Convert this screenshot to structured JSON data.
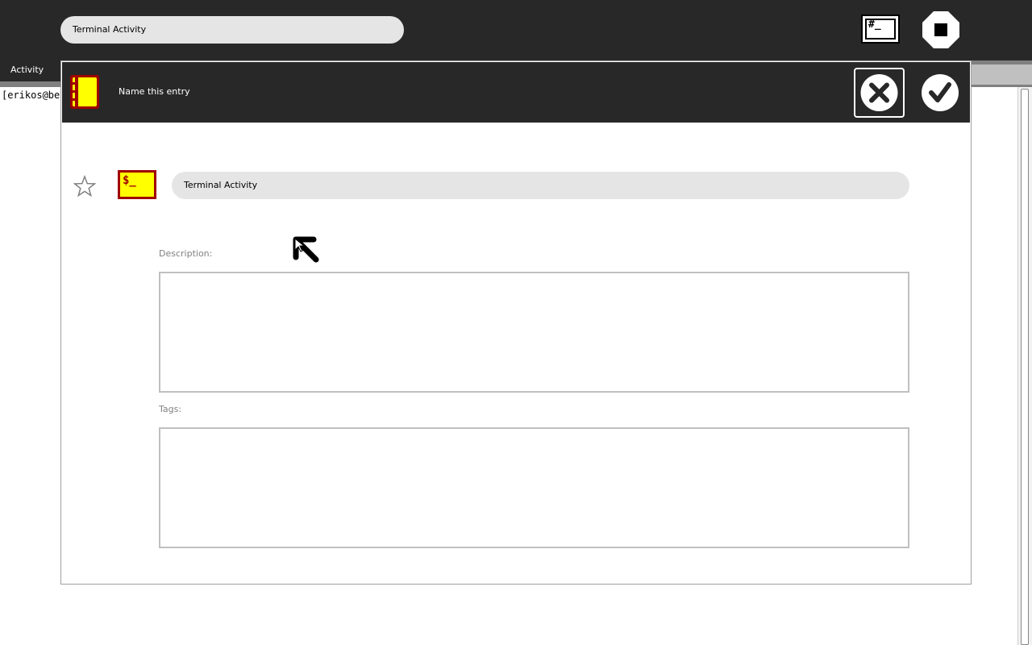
{
  "toolbar": {
    "title_value": "Terminal Activity",
    "terminal_button_glyph": "#_",
    "stop_icon": "stop-icon"
  },
  "subbar": {
    "tab_label": "Activity"
  },
  "terminal": {
    "prompt_text": "[erikos@bee"
  },
  "dialog": {
    "title": "Name this entry",
    "name_value": "Terminal Activity",
    "activity_icon_glyph": "$_",
    "description_label": "Description:",
    "tags_label": "Tags:",
    "description_value": "",
    "tags_value": ""
  },
  "colors": {
    "toolbar_bg": "#282828",
    "entry_bg": "#e5e5e5",
    "icon_fill": "#ffff00",
    "icon_stroke": "#a00000"
  }
}
